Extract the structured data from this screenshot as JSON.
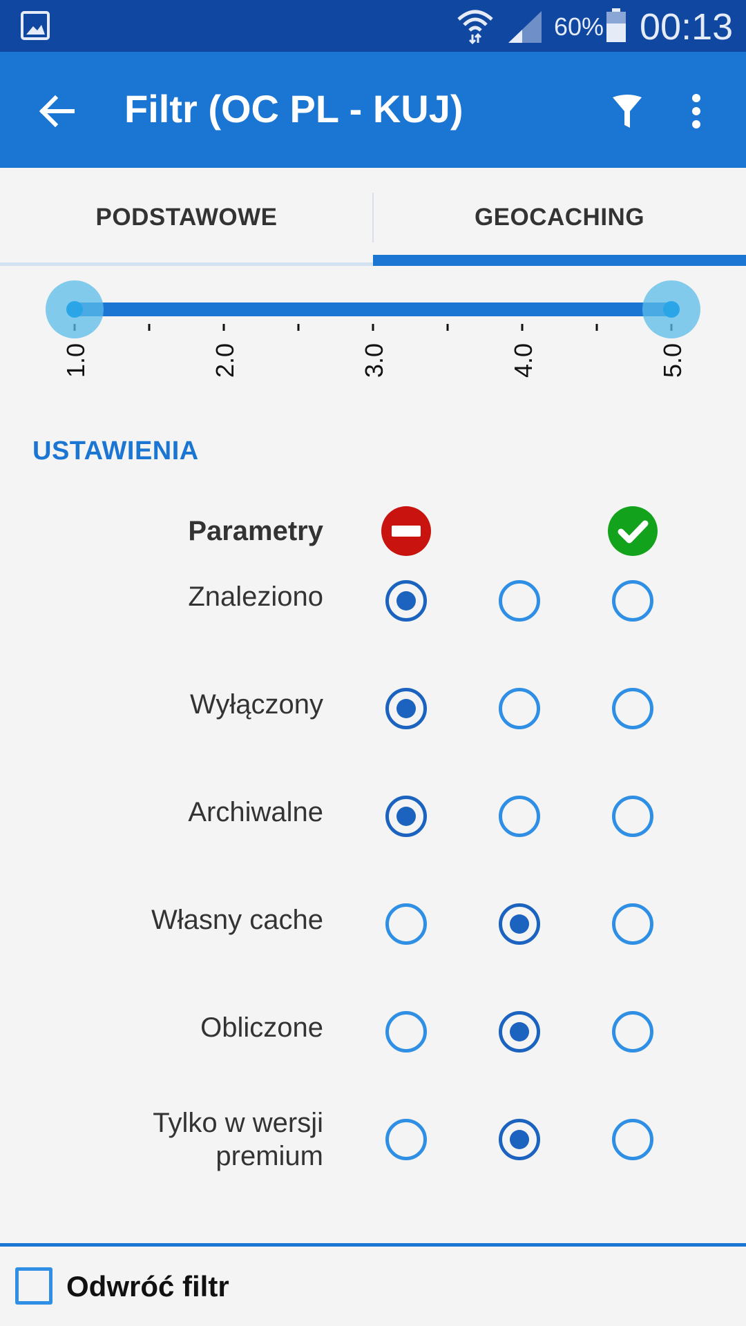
{
  "status_bar": {
    "notification_icon": "image-icon",
    "battery_percent": "60%",
    "time": "00:13"
  },
  "app_bar": {
    "title": "Filtr (OC PL - KUJ)",
    "back_icon": "arrow-left-icon",
    "filter_icon": "funnel-icon",
    "menu_icon": "more-vertical-icon"
  },
  "tabs": [
    {
      "label": "PODSTAWOWE",
      "active": false
    },
    {
      "label": "GEOCACHING",
      "active": true
    }
  ],
  "slider": {
    "min_value": 1.0,
    "max_value": 5.0,
    "ticks": [
      "1.0",
      "2.0",
      "3.0",
      "4.0",
      "5.0"
    ]
  },
  "settings": {
    "title": "USTAWIENIA",
    "header_label": "Parametry",
    "exclude_icon": "no-entry-icon",
    "include_icon": "check-circle-icon",
    "rows": [
      {
        "label": "Znaleziono",
        "selected": 0
      },
      {
        "label": "Wyłączony",
        "selected": 0
      },
      {
        "label": "Archiwalne",
        "selected": 0
      },
      {
        "label": "Własny cache",
        "selected": 1
      },
      {
        "label": "Obliczone",
        "selected": 1
      },
      {
        "label": "Tylko w wersji premium",
        "selected": 1
      }
    ]
  },
  "bottom": {
    "invert_label": "Odwróć filtr",
    "invert_checked": false
  },
  "colors": {
    "status_bar": "#0f47a1",
    "primary": "#1b75d3",
    "exclude": "#c8130e",
    "include": "#13a21b"
  }
}
